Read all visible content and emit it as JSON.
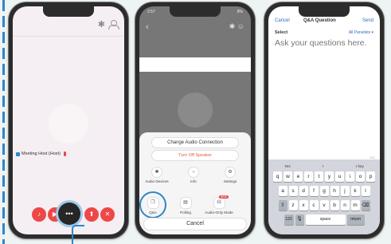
{
  "phone1": {
    "participant_name": "Meeting Host (Host)"
  },
  "phone2": {
    "status_time": "2:57",
    "status_battery": "8%",
    "change_audio": "Change Audio Connection",
    "speaker": "Turn Off Speaker",
    "options": [
      {
        "label": "Audio Devices",
        "icon": "audio-devices-icon"
      },
      {
        "label": "Info",
        "icon": "info-icon"
      },
      {
        "label": "Settings",
        "icon": "settings-icon"
      },
      {
        "label": "Q&A",
        "icon": "qa-icon"
      },
      {
        "label": "Polling",
        "icon": "polling-icon"
      },
      {
        "label": "Audio-Only Mode",
        "icon": "audio-only-icon",
        "badge": "NEW"
      }
    ],
    "cancel": "Cancel"
  },
  "phone3": {
    "cancel": "Cancel",
    "title": "Q&A Question",
    "send": "Send",
    "select_label": "Select",
    "panelists": "All Panelists",
    "prompt": "Ask your questions here.",
    "char_count": "512",
    "suggestions": [
      "Yes",
      "I",
      "I hey"
    ],
    "row1": [
      "q",
      "w",
      "e",
      "r",
      "t",
      "y",
      "u",
      "i",
      "o",
      "p"
    ],
    "row2": [
      "a",
      "s",
      "d",
      "f",
      "g",
      "h",
      "j",
      "k",
      "l"
    ],
    "row3": [
      "z",
      "x",
      "c",
      "v",
      "b",
      "n",
      "m"
    ],
    "shift": "⇧",
    "backspace": "⌫",
    "numbers": "123",
    "mic": "🎙",
    "space": "space",
    "return": "return"
  },
  "colors": {
    "accent": "#2f86c6",
    "red": "#ee4747",
    "link_blue": "#2d6ebf"
  }
}
